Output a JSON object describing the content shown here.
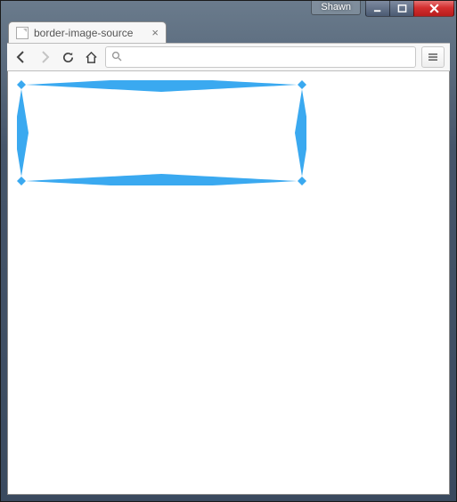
{
  "window": {
    "user_badge": "Shawn"
  },
  "tab": {
    "title": "border-image-source"
  },
  "toolbar": {
    "address_value": ""
  },
  "demo": {
    "border_color": "#3aa9f0"
  }
}
